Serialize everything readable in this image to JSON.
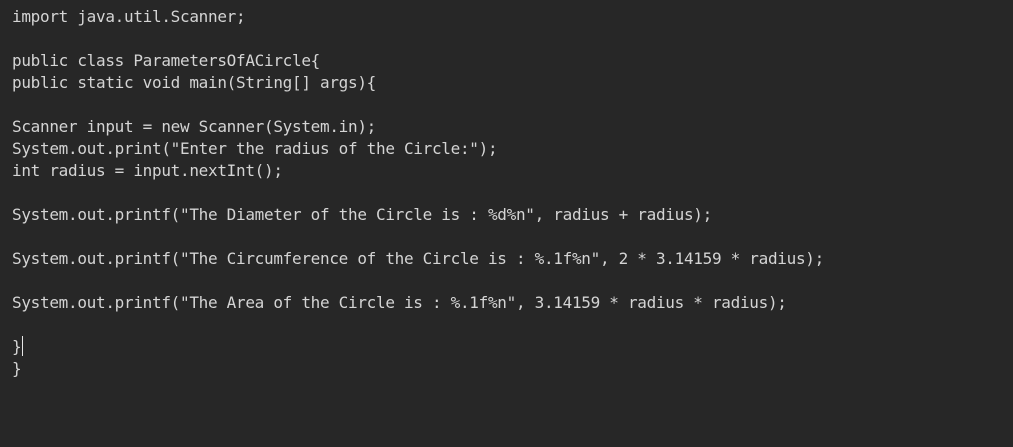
{
  "editor": {
    "lines": [
      "import java.util.Scanner;",
      "",
      "public class ParametersOfACircle{",
      "public static void main(String[] args){",
      "",
      "Scanner input = new Scanner(System.in);",
      "System.out.print(\"Enter the radius of the Circle:\");",
      "int radius = input.nextInt();",
      "",
      "System.out.printf(\"The Diameter of the Circle is : %d%n\", radius + radius);",
      "",
      "System.out.printf(\"The Circumference of the Circle is : %.1f%n\", 2 * 3.14159 * radius);",
      "",
      "System.out.printf(\"The Area of the Circle is : %.1f%n\", 3.14159 * radius * radius);",
      "",
      "}",
      "}"
    ]
  },
  "colors": {
    "background": "#272727",
    "text": "#d4d4d4"
  }
}
